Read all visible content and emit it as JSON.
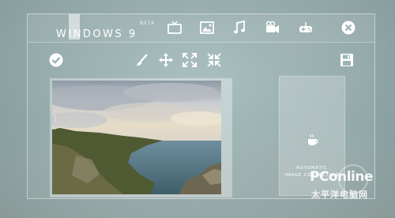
{
  "app": {
    "title": "WINDOWS 9",
    "badge": "BETA"
  },
  "top_nav": [
    {
      "name": "tv-icon"
    },
    {
      "name": "image-icon"
    },
    {
      "name": "music-icon"
    },
    {
      "name": "video-camera-icon"
    },
    {
      "name": "gamepad-icon"
    },
    {
      "name": "close-icon"
    }
  ],
  "toolbar": [
    {
      "name": "confirm-check-icon"
    },
    {
      "name": "brush-icon"
    },
    {
      "name": "move-icon"
    },
    {
      "name": "expand-icon"
    },
    {
      "name": "collapse-icon"
    },
    {
      "name": "save-icon"
    }
  ],
  "side_panel": {
    "icon": "coffee-cup-icon",
    "label_line1": "AUTOMATIC",
    "label_line2": "IMAGE CORRECTION"
  },
  "watermark": {
    "logo": "PConline",
    "subtitle": "太平洋电脑网"
  },
  "colors": {
    "background": "#9fb7b8",
    "accent_white": "#ffffff"
  }
}
